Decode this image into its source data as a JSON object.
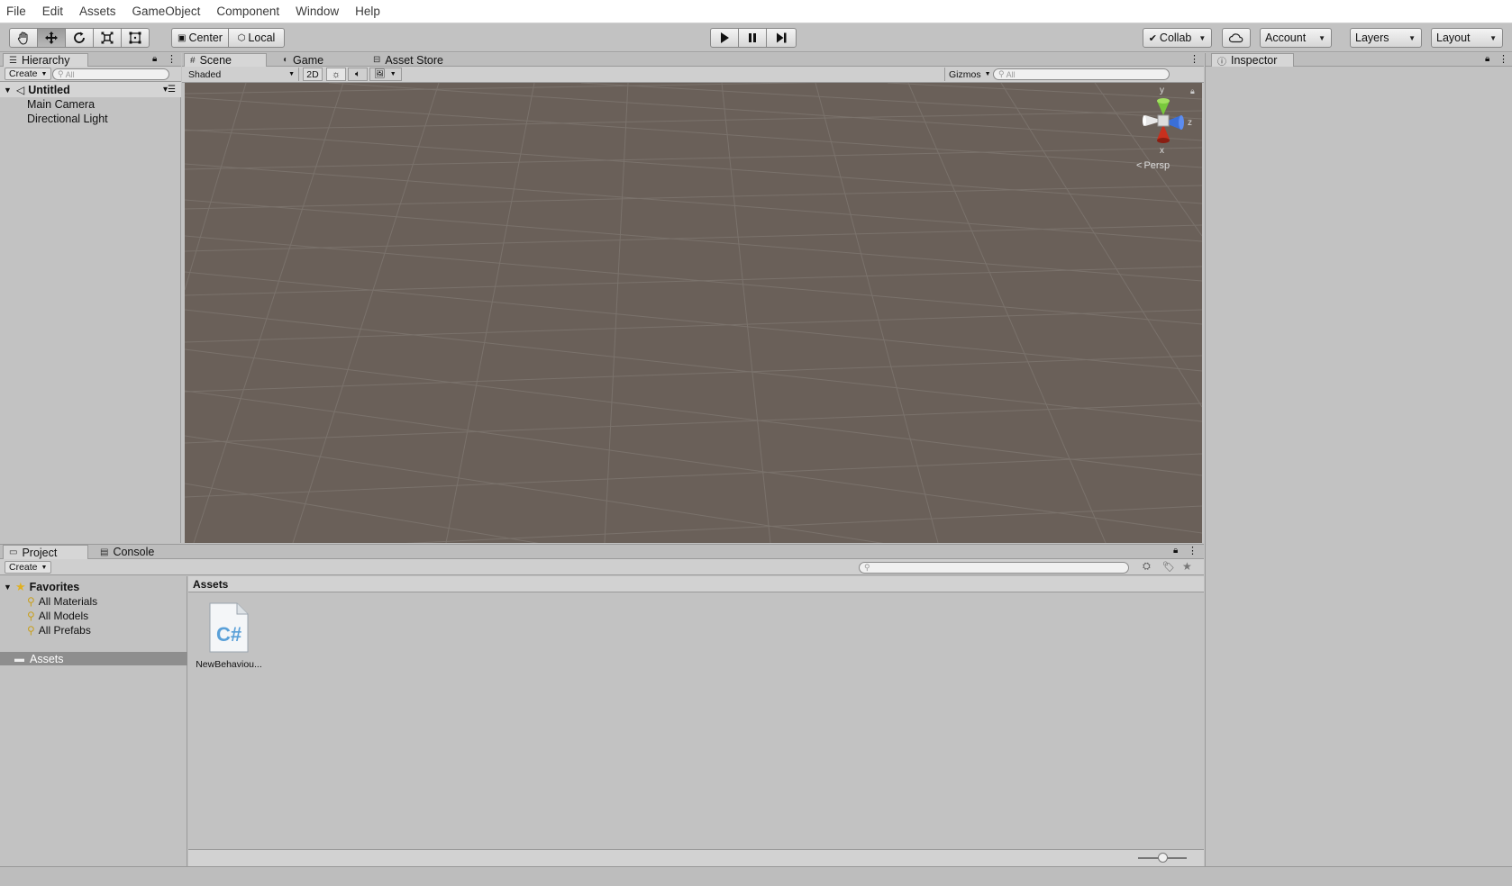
{
  "menubar": {
    "items": [
      "File",
      "Edit",
      "Assets",
      "GameObject",
      "Component",
      "Window",
      "Help"
    ]
  },
  "toolbar": {
    "tools": [
      {
        "icon": "hand-tool-icon"
      },
      {
        "icon": "move-tool-icon"
      },
      {
        "icon": "rotate-tool-icon"
      },
      {
        "icon": "scale-tool-icon"
      },
      {
        "icon": "rect-tool-icon"
      }
    ],
    "active_tool": 1,
    "pivot_mode": "Center",
    "pivot_rotation": "Local",
    "collab": "Collab",
    "account": "Account",
    "layers": "Layers",
    "layout": "Layout"
  },
  "hierarchy": {
    "tab": "Hierarchy",
    "create": "Create",
    "search_placeholder": "All",
    "scene_name": "Untitled",
    "items": [
      "Main Camera",
      "Directional Light"
    ]
  },
  "scene": {
    "tabs": [
      "Scene",
      "Game",
      "Asset Store"
    ],
    "shading": "Shaded",
    "mode_2d": "2D",
    "gizmos": "Gizmos",
    "search_placeholder": "All",
    "axis_labels": {
      "y": "y",
      "z": "z",
      "x": "x"
    },
    "projection": "Persp"
  },
  "inspector": {
    "tab": "Inspector"
  },
  "project": {
    "tabs": [
      "Project",
      "Console"
    ],
    "create": "Create",
    "favorites_label": "Favorites",
    "favorites": [
      "All Materials",
      "All Models",
      "All Prefabs"
    ],
    "assets_folder": "Assets",
    "breadcrumb": "Assets",
    "files": [
      {
        "name": "NewBehaviou...",
        "icon": "csharp-script-icon",
        "glyph": "C#"
      }
    ]
  },
  "colors": {
    "scene_bg": "#6a6059",
    "selected_folder": "#8e8e8e",
    "panel_bg": "#c2c2c2",
    "axis_y": "#78c83c",
    "axis_z": "#3a6fd8",
    "axis_x": "#c8301e"
  }
}
